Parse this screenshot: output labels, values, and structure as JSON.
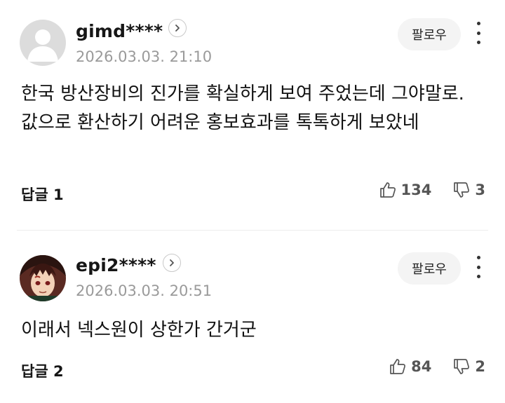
{
  "comments": [
    {
      "username": "gimd****",
      "date": "2026.03.03. 21:10",
      "follow_label": "팔로우",
      "text": "한국 방산장비의 진가를 확실하게 보여 주었는데 그야말로. 값으로 환산하기 어려운 홍보효과를 톡톡하게 보았네",
      "reply_label": "답글 1",
      "likes": "134",
      "dislikes": "3",
      "avatar": "default-avatar-icon"
    },
    {
      "username": "epi2****",
      "date": "2026.03.03. 20:51",
      "follow_label": "팔로우",
      "text": "이래서 넥스원이 상한가 간거군",
      "reply_label": "답글 2",
      "likes": "84",
      "dislikes": "2",
      "avatar": "anime-character-avatar"
    }
  ],
  "colors": {
    "text": "#111111",
    "muted": "#9a9a9a",
    "follow_bg": "#f4f4f4",
    "divider": "#ededed"
  }
}
